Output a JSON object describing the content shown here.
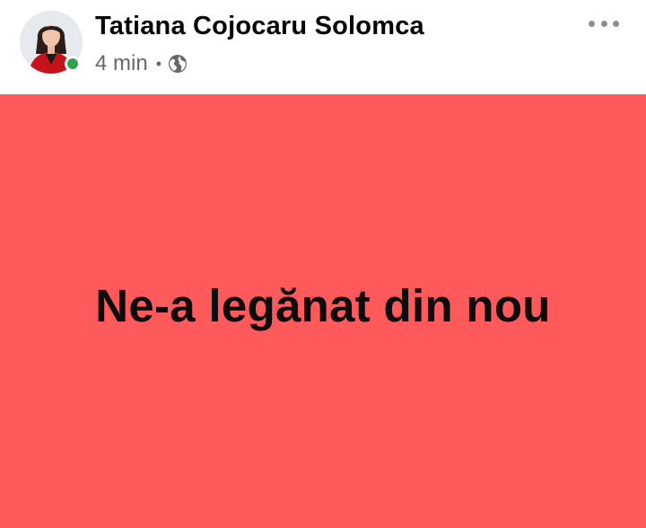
{
  "post": {
    "author": {
      "name": "Tatiana Cojocaru Solomca",
      "online": true,
      "avatar_icon": "profile-photo"
    },
    "meta": {
      "time": "4 min",
      "separator": "•",
      "privacy_icon": "globe-icon",
      "privacy": "Public"
    },
    "more_icon": "more-horizontal-icon",
    "status": {
      "text": "Ne-a legănat din nou",
      "background_color": "#fe595b",
      "text_color": "#0c0c0c"
    }
  },
  "colors": {
    "online_indicator": "#31a24c",
    "meta_text": "#65676b",
    "name_text": "#050505"
  }
}
